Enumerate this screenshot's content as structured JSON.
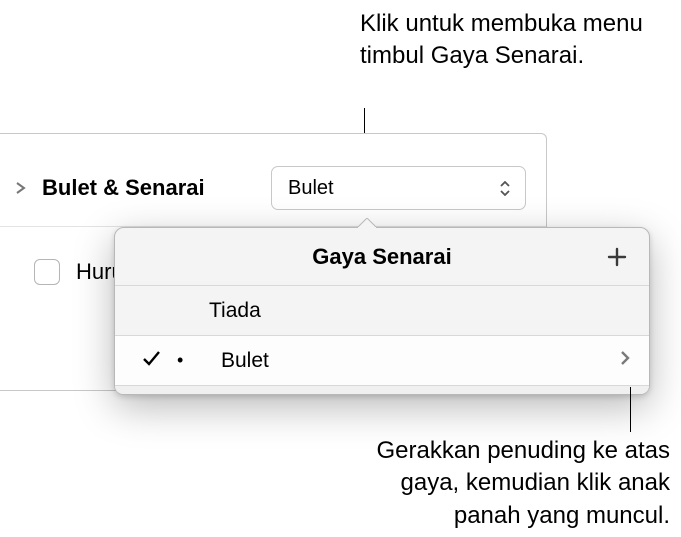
{
  "annotations": {
    "top": "Klik untuk membuka menu timbul Gaya Senarai.",
    "bottom": "Gerakkan penuding ke atas gaya, kemudian klik anak panah yang muncul."
  },
  "section": {
    "title": "Bulet & Senarai",
    "popup_value": "Bulet"
  },
  "checkbox_row": {
    "label": "Huru"
  },
  "popup": {
    "title": "Gaya Senarai",
    "items": [
      {
        "label": "Tiada",
        "selected": false,
        "has_chevron": false,
        "has_bullet": false
      },
      {
        "label": "Bulet",
        "selected": true,
        "has_chevron": true,
        "has_bullet": true
      }
    ]
  }
}
